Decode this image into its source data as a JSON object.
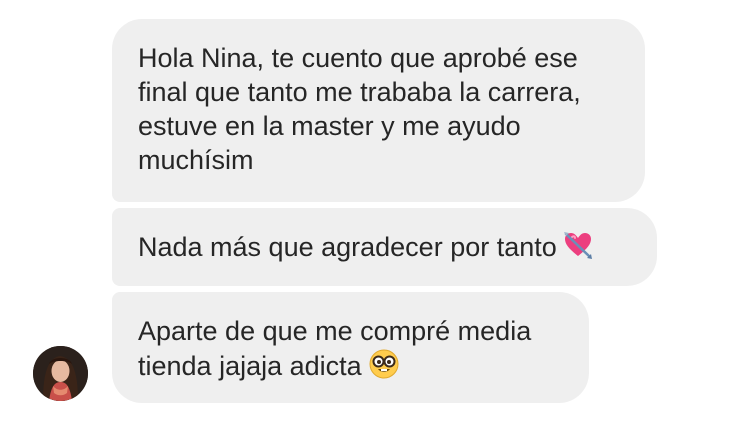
{
  "messages": [
    {
      "lines": [
        "Hola Nina, te cuento que aprobé ese",
        "final que tanto me trababa la carrera,",
        "estuve en la master y me ayudo",
        "muchísim"
      ]
    },
    {
      "lines": [
        "Nada más que agradecer por tanto"
      ],
      "emoji": "heart-with-arrow-icon"
    },
    {
      "lines": [
        "Aparte de que me compré media",
        "tienda jajaja adicta"
      ],
      "emoji": "nerd-face-icon"
    }
  ],
  "sender": {
    "avatar": "profile-photo"
  },
  "colors": {
    "bubble_bg": "#efefef",
    "text": "#262626",
    "background": "#ffffff"
  }
}
